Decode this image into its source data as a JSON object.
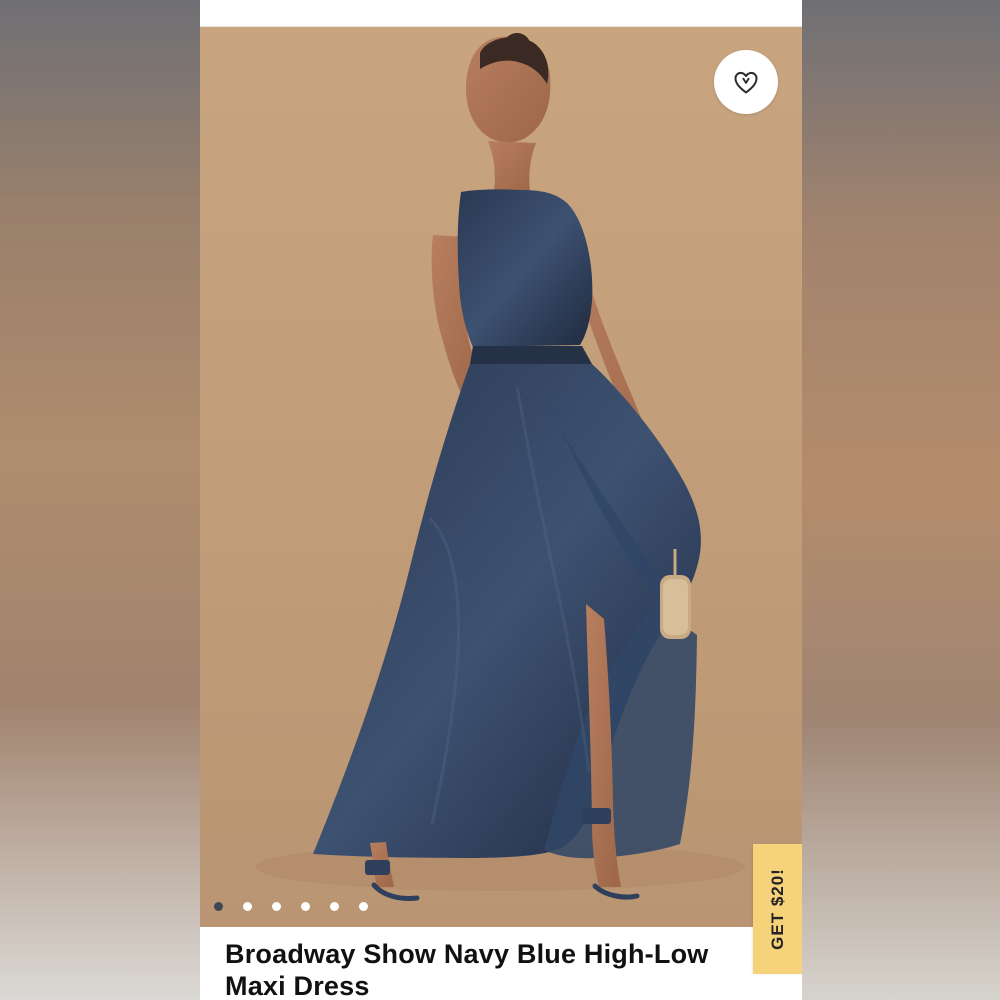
{
  "app": {
    "background": "#b48b68",
    "panel": "#ffffff",
    "hero_background": "#c4a07d",
    "dress_color": "#2f405c",
    "accent_yellow": "#f6d27a"
  },
  "product": {
    "title": "Broadway Show Navy Blue High-Low Maxi Dress",
    "wishlist_icon": "heart-icon",
    "carousel": {
      "dot_count": 6,
      "active_index": 0
    }
  },
  "promo": {
    "label": "GET $20!"
  }
}
